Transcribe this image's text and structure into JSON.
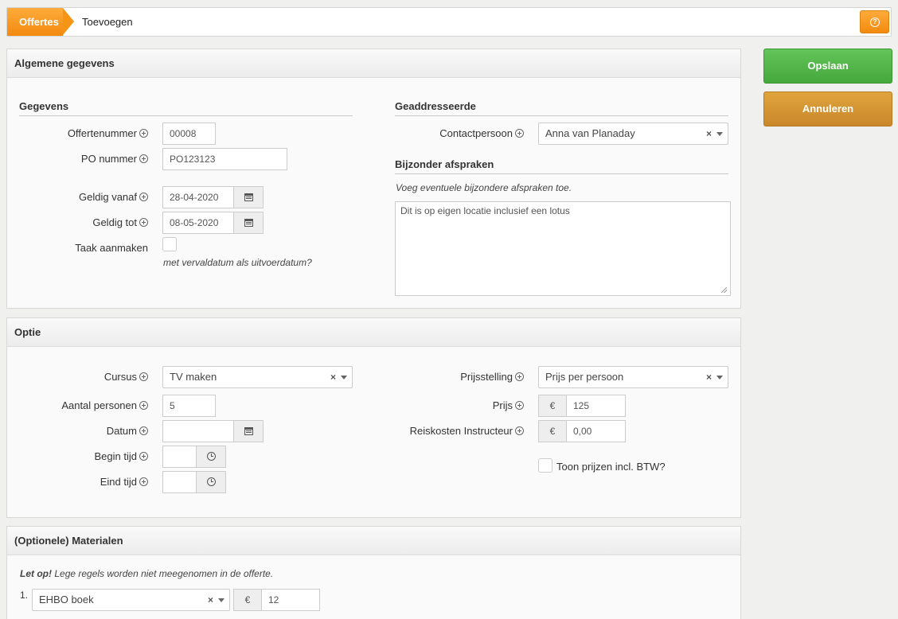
{
  "breadcrumb": {
    "root": "Offertes",
    "current": "Toevoegen"
  },
  "actions": {
    "save": "Opslaan",
    "cancel": "Annuleren"
  },
  "general": {
    "panel_title": "Algemene gegevens",
    "details_title": "Gegevens",
    "offer_number_label": "Offertenummer",
    "offer_number": "00008",
    "po_label": "PO nummer",
    "po_number": "PO123123",
    "valid_from_label": "Geldig vanaf",
    "valid_from": "28-04-2020",
    "valid_to_label": "Geldig tot",
    "valid_to": "08-05-2020",
    "task_label": "Taak aanmaken",
    "task_hint": "met vervaldatum als uitvoerdatum?",
    "addressee_title": "Geaddresseerde",
    "contact_label": "Contactpersoon",
    "contact_value": "Anna van Planaday",
    "special_title": "Bijzonder afspraken",
    "special_hint": "Voeg eventuele bijzondere afspraken toe.",
    "special_text": "Dit is op eigen locatie inclusief een lotus"
  },
  "option": {
    "panel_title": "Optie",
    "course_label": "Cursus",
    "course_value": "TV maken",
    "persons_label": "Aantal personen",
    "persons_value": "5",
    "date_label": "Datum",
    "date_value": "",
    "start_label": "Begin tijd",
    "end_label": "Eind tijd",
    "pricing_label": "Prijsstelling",
    "pricing_value": "Prijs per persoon",
    "price_label": "Prijs",
    "currency": "€",
    "price_value": "125",
    "travel_label": "Reiskosten Instructeur",
    "travel_value": "0,00",
    "incl_vat_label": "Toon prijzen incl. BTW?"
  },
  "materials": {
    "panel_title": "(Optionele) Materialen",
    "note_bold": "Let op!",
    "note_text": "Lege regels worden niet meegenomen in de offerte.",
    "rows": [
      {
        "index": "1.",
        "item": "EHBO boek",
        "currency": "€",
        "price": "12"
      }
    ]
  },
  "icons": {
    "clear": "×",
    "help": "?"
  }
}
